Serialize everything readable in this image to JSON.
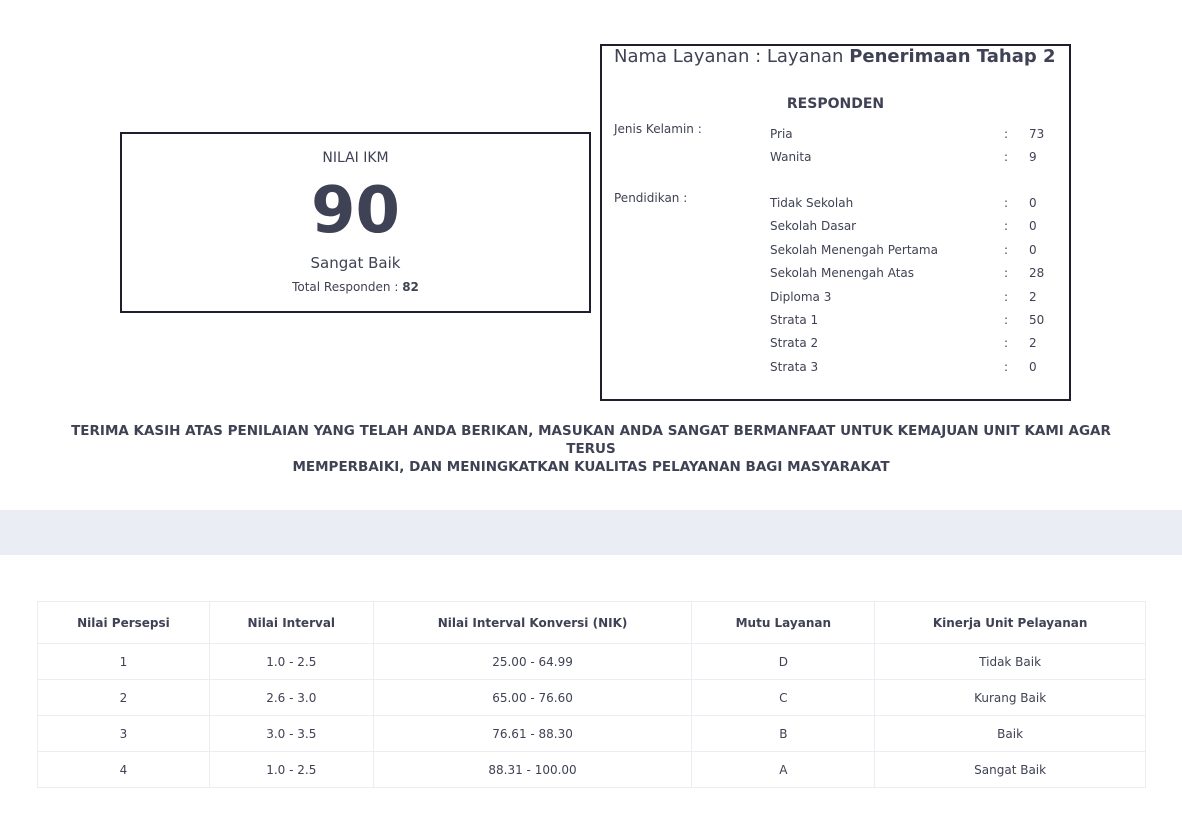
{
  "ikm": {
    "title": "NILAI IKM",
    "value": "90",
    "mutu": "Sangat Baik",
    "total_label": "Total Responden : ",
    "total_value": "82"
  },
  "layanan": {
    "prefix": "Nama Layanan : Layanan ",
    "name": "Penerimaan Tahap 2"
  },
  "responden": {
    "title": "RESPONDEN",
    "gender_label": "Jenis Kelamin :",
    "gender": [
      {
        "label": "Pria",
        "sep": ":",
        "value": "73"
      },
      {
        "label": "Wanita",
        "sep": ":",
        "value": "9"
      }
    ],
    "education_label": "Pendidikan :",
    "education": [
      {
        "label": "Tidak Sekolah",
        "sep": ":",
        "value": "0"
      },
      {
        "label": "Sekolah Dasar",
        "sep": ":",
        "value": "0"
      },
      {
        "label": "Sekolah Menengah Pertama",
        "sep": ":",
        "value": "0"
      },
      {
        "label": "Sekolah Menengah Atas",
        "sep": ":",
        "value": "28"
      },
      {
        "label": "Diploma 3",
        "sep": ":",
        "value": "2"
      },
      {
        "label": "Strata 1",
        "sep": ":",
        "value": "50"
      },
      {
        "label": "Strata 2",
        "sep": ":",
        "value": "2"
      },
      {
        "label": "Strata 3",
        "sep": ":",
        "value": "0"
      }
    ]
  },
  "thanks": {
    "line1": "TERIMA KASIH ATAS PENILAIAN YANG TELAH ANDA BERIKAN, MASUKAN ANDA SANGAT BERMANFAAT UNTUK KEMAJUAN UNIT KAMI AGAR TERUS",
    "line2": "MEMPERBAIKI, DAN MENINGKATKAN KUALITAS PELAYANAN BAGI MASYARAKAT"
  },
  "table": {
    "headers": [
      "Nilai Persepsi",
      "Nilai Interval",
      "Nilai Interval Konversi (NIK)",
      "Mutu Layanan",
      "Kinerja Unit Pelayanan"
    ],
    "rows": [
      [
        "1",
        "1.0 - 2.5",
        "25.00 - 64.99",
        "D",
        "Tidak Baik"
      ],
      [
        "2",
        "2.6 - 3.0",
        "65.00 - 76.60",
        "C",
        "Kurang Baik"
      ],
      [
        "3",
        "3.0 - 3.5",
        "76.61 - 88.30",
        "B",
        "Baik"
      ],
      [
        "4",
        "1.0 - 2.5",
        "88.31 - 100.00",
        "A",
        "Sangat Baik"
      ]
    ]
  },
  "colors": {
    "text": "#3f4254",
    "border_dark": "#1e1e2d",
    "band": "#eaedf4",
    "table_border": "#ebedf3"
  }
}
